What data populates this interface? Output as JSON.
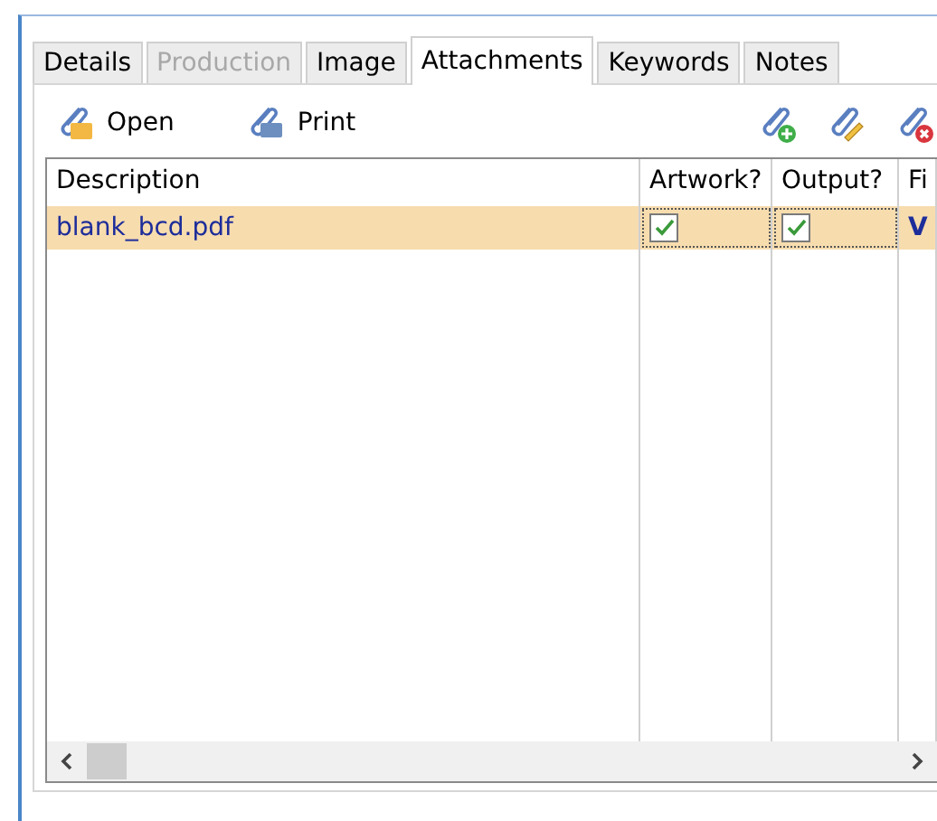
{
  "tabs": [
    {
      "label": "Details",
      "selected": false,
      "disabled": false
    },
    {
      "label": "Production",
      "selected": false,
      "disabled": true
    },
    {
      "label": "Image",
      "selected": false,
      "disabled": false
    },
    {
      "label": "Attachments",
      "selected": true,
      "disabled": false
    },
    {
      "label": "Keywords",
      "selected": false,
      "disabled": false
    },
    {
      "label": "Notes",
      "selected": false,
      "disabled": false
    }
  ],
  "toolbar": {
    "buttons": [
      {
        "kind": "open",
        "label": "Open"
      },
      {
        "kind": "print",
        "label": "Print"
      }
    ],
    "icons": [
      {
        "kind": "add"
      },
      {
        "kind": "edit"
      },
      {
        "kind": "remove"
      }
    ]
  },
  "table": {
    "columns": [
      "Description",
      "Artwork?",
      "Output?",
      "Fi"
    ],
    "rows": [
      {
        "selected": true,
        "description": "blank_bcd.pdf",
        "artwork": true,
        "output": true,
        "column_4": "V"
      }
    ]
  }
}
